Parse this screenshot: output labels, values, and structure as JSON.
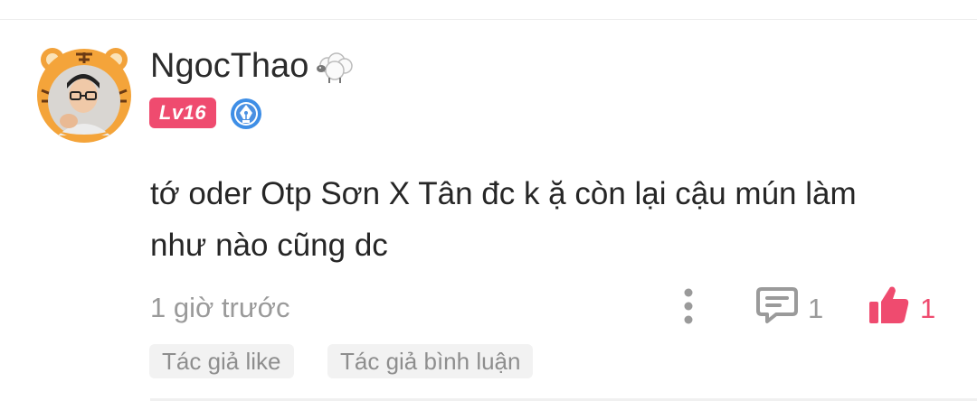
{
  "user": {
    "name": "NgocThao",
    "level": "Lv16"
  },
  "comment": {
    "line1": "tớ oder Otp Sơn X Tân đc k ặ còn lại cậu mún làm",
    "line2": "như nào cũng dc"
  },
  "meta": {
    "timestamp": "1 giờ trước",
    "reply_count": "1",
    "like_count": "1"
  },
  "tags": [
    "Tác giả like",
    "Tác giả bình luận"
  ],
  "icons": {
    "avatar": "tiger-hood-avatar",
    "name_decoration": "sheep-icon",
    "verified": "pen-nib-badge-icon",
    "more": "vertical-dots-icon",
    "reply": "comment-bubble-icon",
    "like": "thumbs-up-icon"
  },
  "colors": {
    "accent": "#ef4b6f",
    "muted_text": "#9a9a9a",
    "badge_blue": "#4a90e2"
  }
}
